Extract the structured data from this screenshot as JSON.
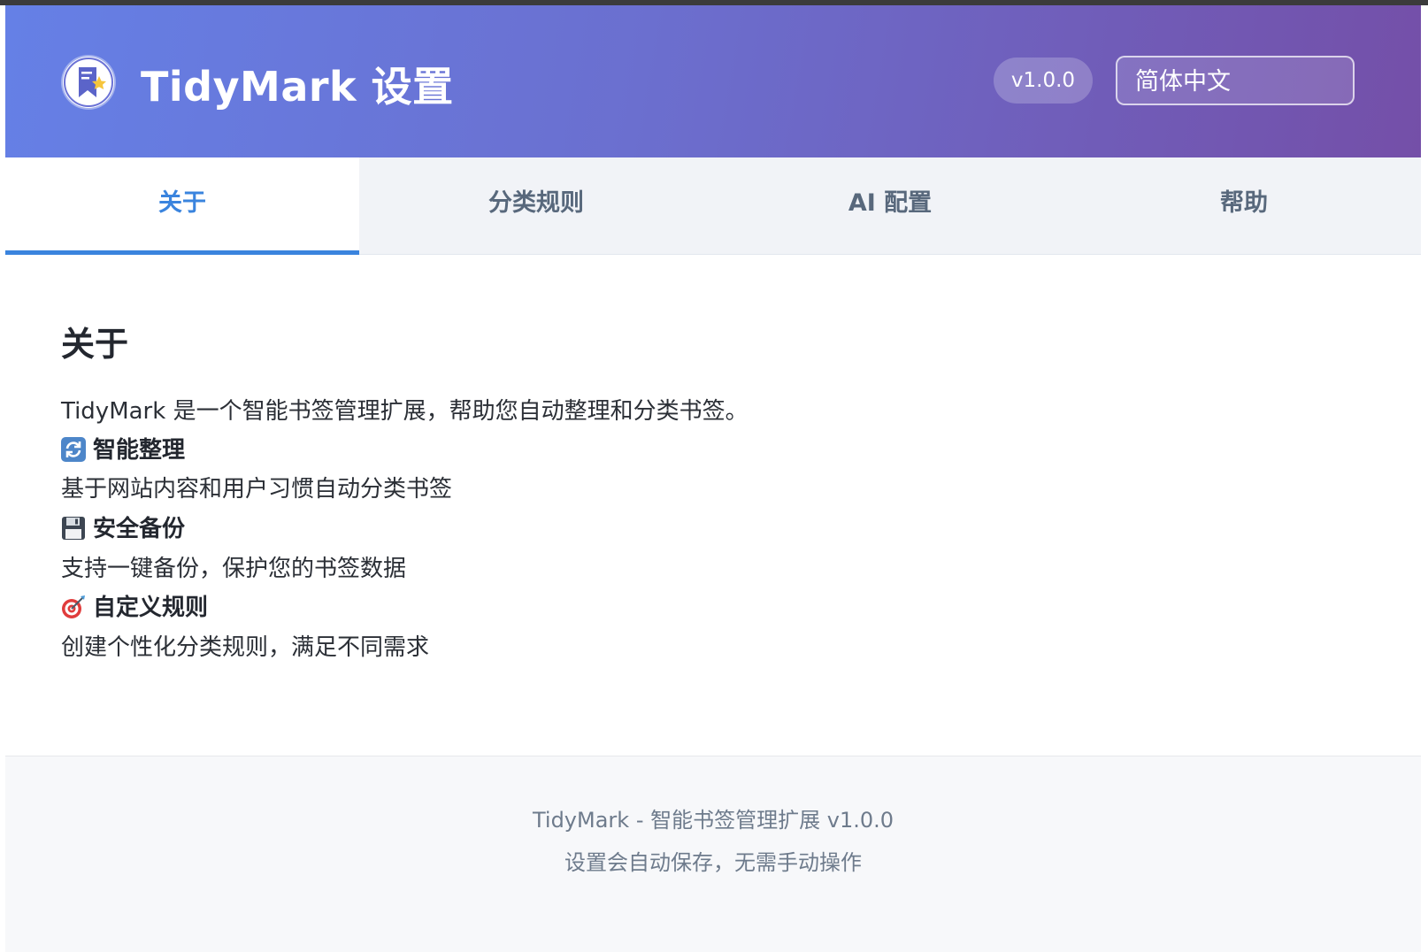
{
  "header": {
    "title": "TidyMark 设置",
    "logo_icon": "bookmark-star-icon",
    "version": "v1.0.0",
    "language_selected": "简体中文"
  },
  "tabs": [
    {
      "label": "关于",
      "active": true
    },
    {
      "label": "分类规则",
      "active": false
    },
    {
      "label": "AI 配置",
      "active": false
    },
    {
      "label": "帮助",
      "active": false
    }
  ],
  "about": {
    "title": "关于",
    "intro": "TidyMark 是一个智能书签管理扩展，帮助您自动整理和分类书签。",
    "features": [
      {
        "icon": "refresh-icon",
        "title": "智能整理",
        "desc": "基于网站内容和用户习惯自动分类书签"
      },
      {
        "icon": "floppy-disk-icon",
        "title": "安全备份",
        "desc": "支持一键备份，保护您的书签数据"
      },
      {
        "icon": "target-dart-icon",
        "title": "自定义规则",
        "desc": "创建个性化分类规则，满足不同需求"
      }
    ]
  },
  "footer": {
    "line1": "TidyMark - 智能书签管理扩展 v1.0.0",
    "line2": "设置会自动保存，无需手动操作"
  },
  "colors": {
    "header_gradient_start": "#6580e6",
    "header_gradient_end": "#744fa8",
    "accent": "#3a84de",
    "tab_bar_bg": "#f1f3f7",
    "footer_bg": "#f7f8fa"
  }
}
